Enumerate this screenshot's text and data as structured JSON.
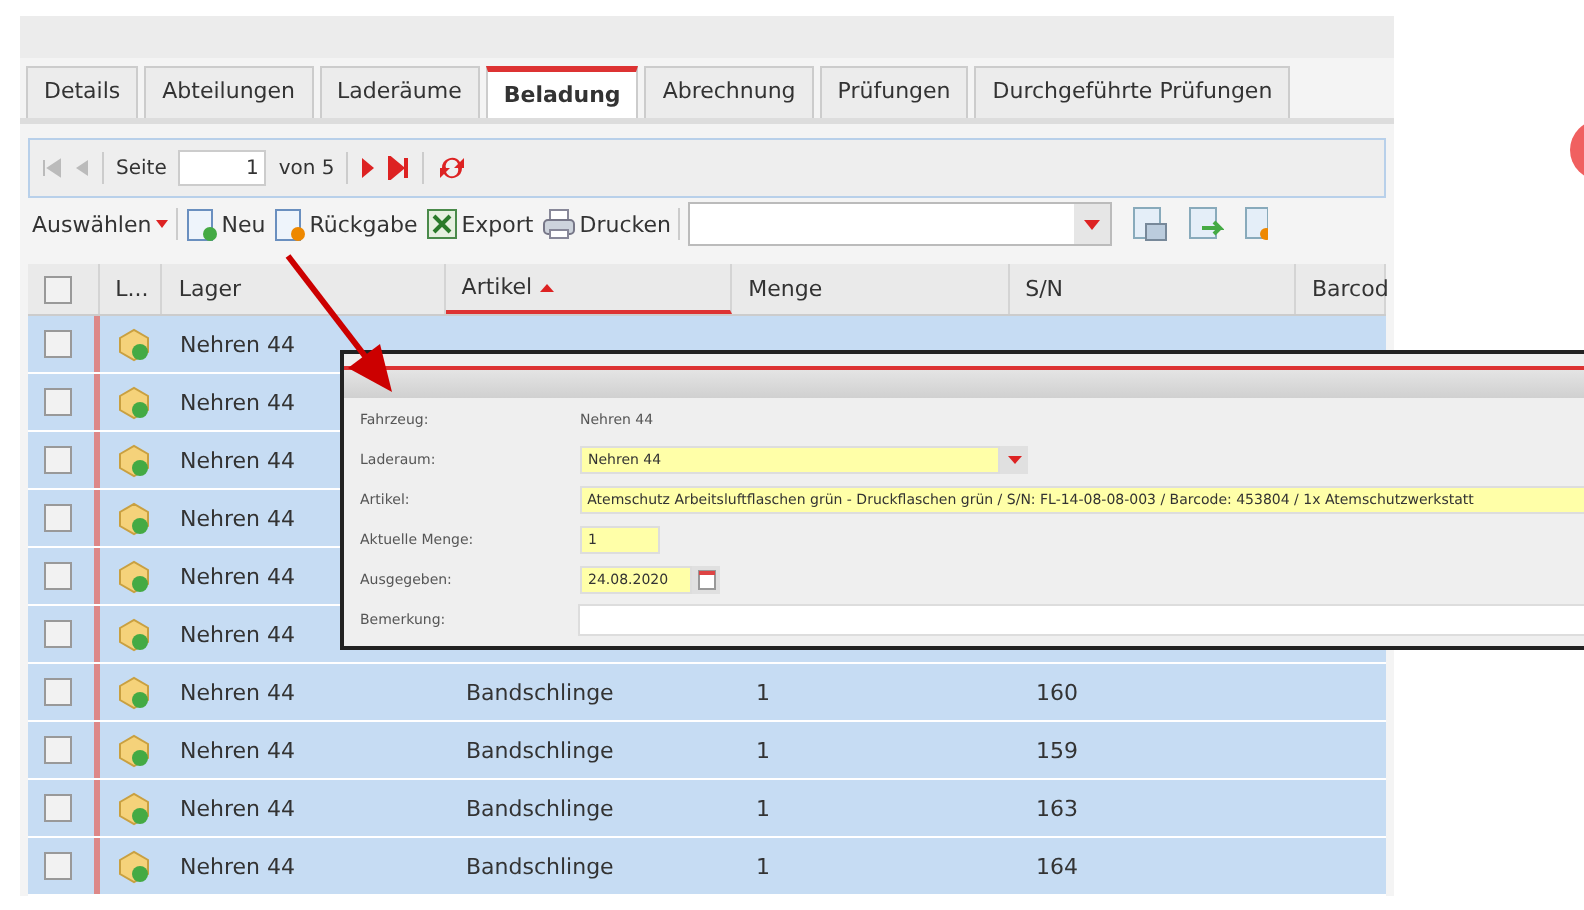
{
  "tabs": [
    {
      "label": "Details",
      "selected": false
    },
    {
      "label": "Abteilungen",
      "selected": false
    },
    {
      "label": "Laderäume",
      "selected": false
    },
    {
      "label": "Beladung",
      "selected": true
    },
    {
      "label": "Abrechnung",
      "selected": false
    },
    {
      "label": "Prüfungen",
      "selected": false
    },
    {
      "label": "Durchgeführte Prüfungen",
      "selected": false
    }
  ],
  "pager": {
    "page_label": "Seite",
    "page": "1",
    "of_label": "von 5"
  },
  "actions": {
    "select": "Auswählen",
    "buttons": [
      {
        "label": "Neu",
        "kind": "new"
      },
      {
        "label": "Rückgabe",
        "kind": "return"
      },
      {
        "label": "Export",
        "kind": "export"
      },
      {
        "label": "Drucken",
        "kind": "print"
      }
    ]
  },
  "table": {
    "all_checked": false,
    "columns": [
      {
        "label": "L...",
        "sorted": false
      },
      {
        "label": "Lager",
        "sorted": false
      },
      {
        "label": "Artikel",
        "sorted": true
      },
      {
        "label": "Menge",
        "sorted": false
      },
      {
        "label": "S/N",
        "sorted": false
      },
      {
        "label": "Barcod",
        "sorted": false
      }
    ],
    "rows": [
      {
        "checked": false,
        "lager": "Nehren 44"
      },
      {
        "checked": false,
        "lager": "Nehren 44"
      },
      {
        "checked": false,
        "lager": "Nehren 44"
      },
      {
        "checked": false,
        "lager": "Nehren 44"
      },
      {
        "checked": false,
        "lager": "Nehren 44"
      },
      {
        "checked": false,
        "lager": "Nehren 44"
      },
      {
        "checked": false,
        "lager": "Nehren 44",
        "artikel": "Bandschlinge",
        "menge": "1",
        "sn": "160"
      },
      {
        "checked": false,
        "lager": "Nehren 44",
        "artikel": "Bandschlinge",
        "menge": "1",
        "sn": "159"
      },
      {
        "checked": false,
        "lager": "Nehren 44",
        "artikel": "Bandschlinge",
        "menge": "1",
        "sn": "163"
      },
      {
        "checked": false,
        "lager": "Nehren 44",
        "artikel": "Bandschlinge",
        "menge": "1",
        "sn": "164"
      }
    ]
  },
  "popup": {
    "fields": [
      {
        "label": "Fahrzeug:",
        "kind": "text",
        "value": "Nehren 44"
      },
      {
        "label": "Laderaum:",
        "kind": "combo",
        "value": "Nehren 44"
      },
      {
        "label": "Artikel:",
        "kind": "wide",
        "value": "Atemschutz Arbeitsluftflaschen grün - Druckflaschen grün / S/N: FL-14-08-08-003 / Barcode: 453804 / 1x Atemschutzwerkstatt"
      },
      {
        "label": "Aktuelle Menge:",
        "kind": "short",
        "value": "1"
      },
      {
        "label": "Ausgegeben:",
        "kind": "date",
        "value": "24.08.2020"
      },
      {
        "label": "Bemerkung:",
        "kind": "empty"
      }
    ]
  }
}
